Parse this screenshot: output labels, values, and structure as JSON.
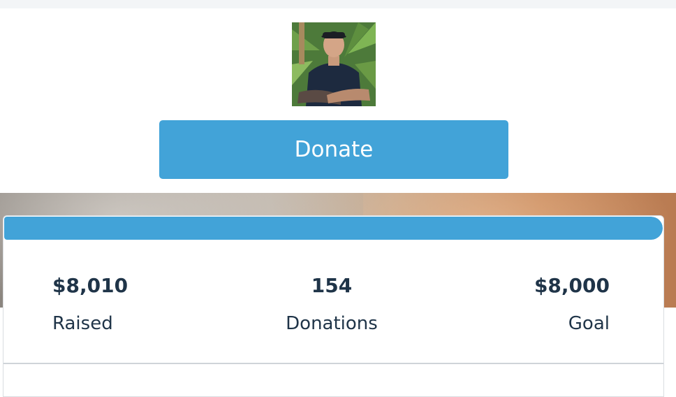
{
  "colors": {
    "accent": "#42a3d8",
    "text": "#1f3448"
  },
  "profile": {
    "alt": "Campaign organizer photo"
  },
  "donate": {
    "label": "Donate"
  },
  "progress": {
    "fraction": 1.0
  },
  "stats": {
    "raised": {
      "value": "$8,010",
      "label": "Raised"
    },
    "donations": {
      "value": "154",
      "label": "Donations"
    },
    "goal": {
      "value": "$8,000",
      "label": "Goal"
    }
  }
}
